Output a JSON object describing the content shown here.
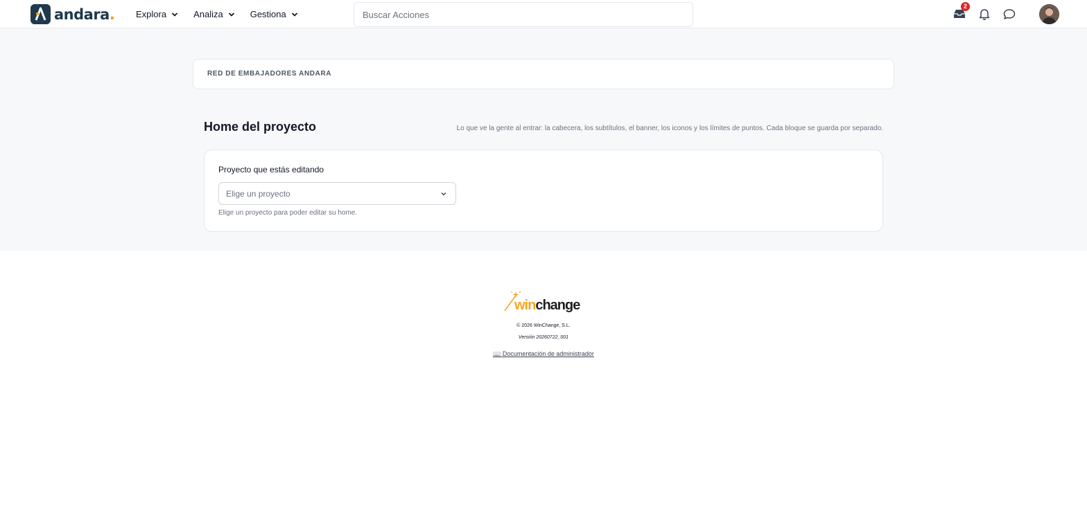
{
  "brand": {
    "name": "andara",
    "dot": "."
  },
  "nav": {
    "items": [
      {
        "label": "Explora"
      },
      {
        "label": "Analiza"
      },
      {
        "label": "Gestiona"
      }
    ]
  },
  "search": {
    "placeholder": "Buscar Acciones",
    "value": ""
  },
  "header_icons": {
    "inbox_badge": "2"
  },
  "org": {
    "name": "RED DE EMBAJADORES ANDARA"
  },
  "page": {
    "title": "Home del proyecto",
    "description": "Lo que ve la gente al entrar: la cabecera, los subtítulos, el banner, los iconos y los límites de puntos. Cada bloque se guarda por separado."
  },
  "editor": {
    "field_label": "Proyecto que estás editando",
    "select_placeholder": "Elige un proyecto",
    "help_text": "Elige un proyecto para poder editar su home."
  },
  "footer": {
    "brand_part1": "win",
    "brand_part2": "change",
    "copyright": "© 2026 WinChange, S.L.",
    "version": "Versión 20260722_001",
    "docs_icon": "📖",
    "docs_link": "Documentación de administrador"
  },
  "colors": {
    "brand_primary": "#1e3a4c",
    "accent": "#f59e0b",
    "badge": "#dc2626",
    "page_bg": "#f7f8fa"
  }
}
